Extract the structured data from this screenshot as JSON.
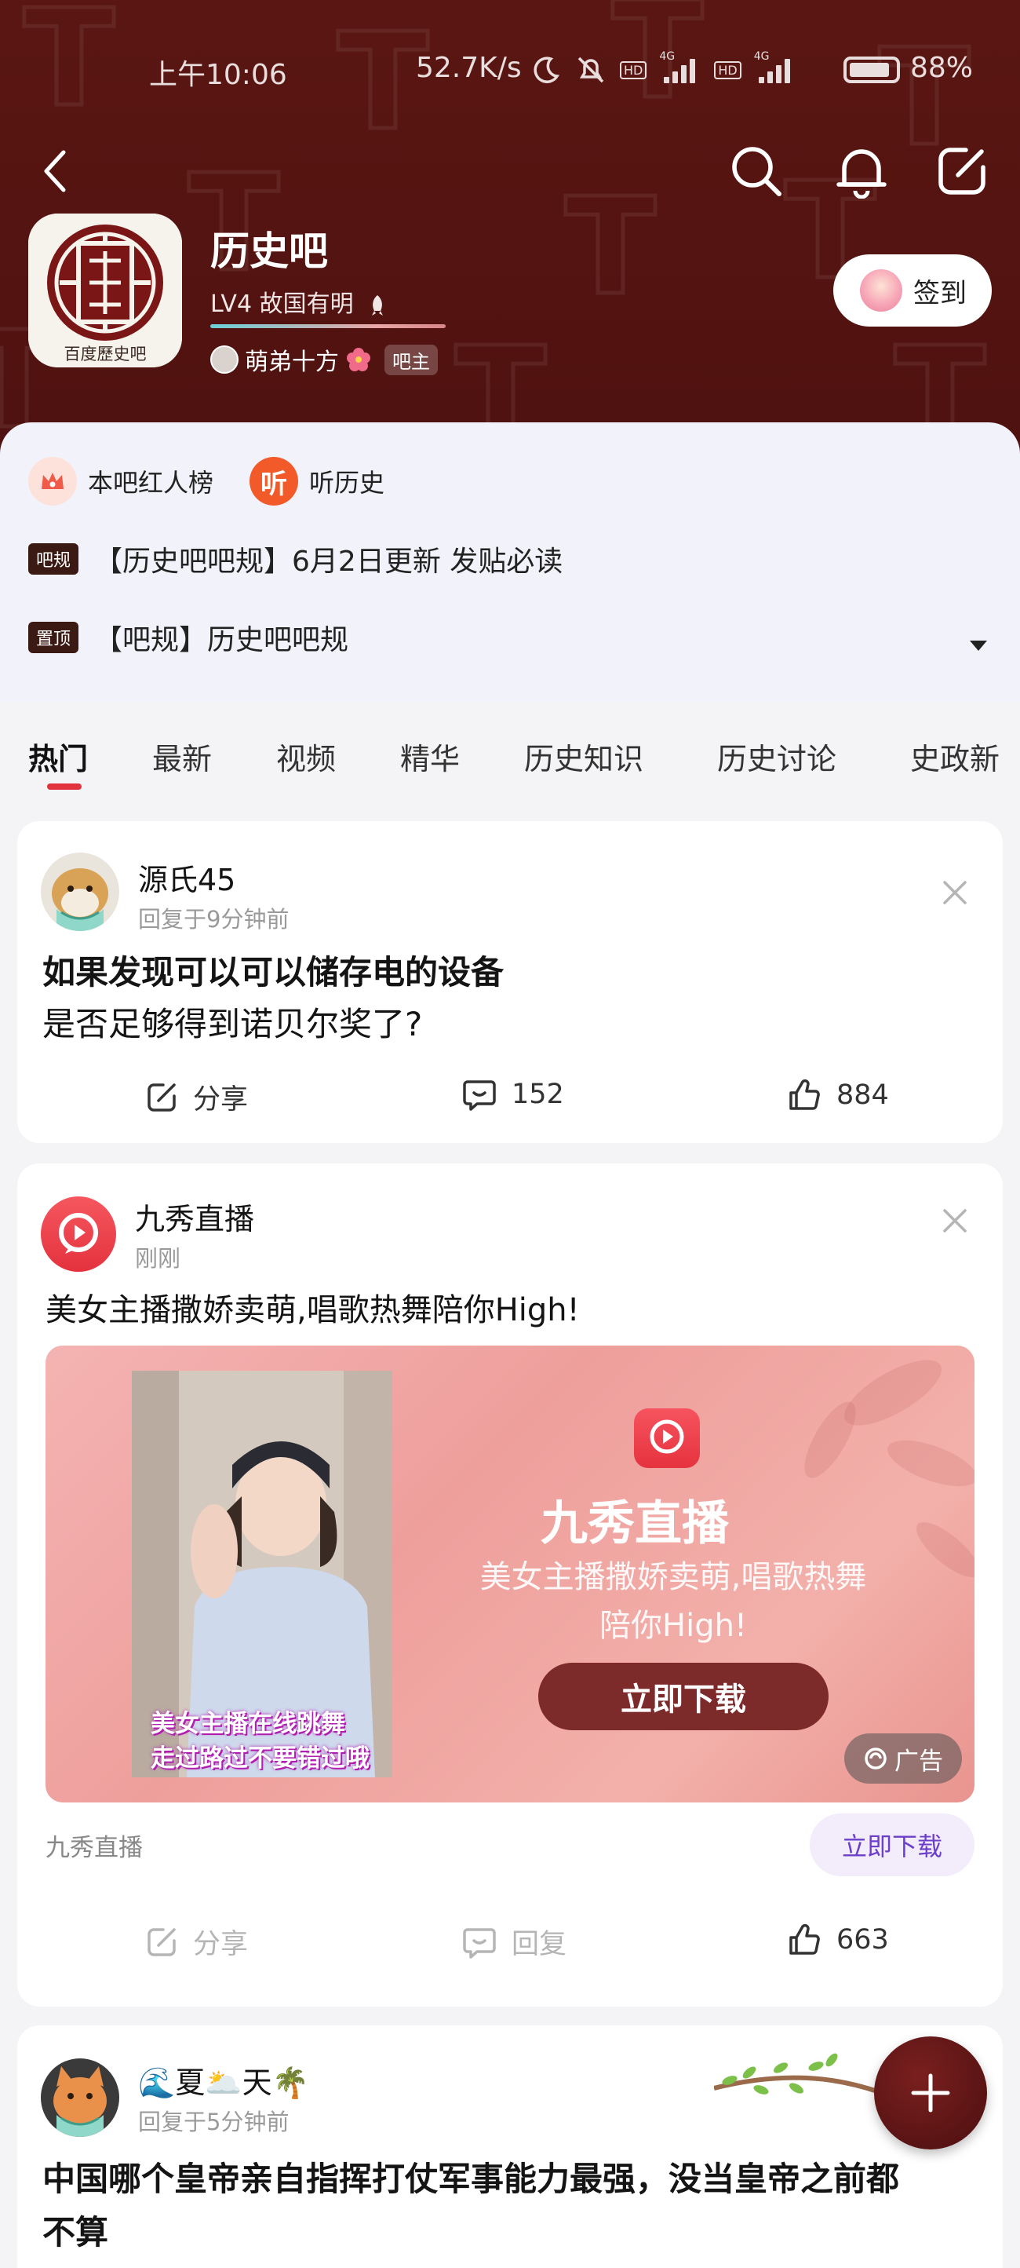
{
  "status_bar": {
    "time": "上午10:06",
    "net_speed": "52.7K/s",
    "net_a": "4G",
    "net_b": "4G",
    "battery": "88%"
  },
  "forum": {
    "name": "历史吧",
    "level": "LV4 故国有明",
    "level_icon": "rocket-icon",
    "owner_name": "萌弟十方",
    "owner_tag": "吧主",
    "logo_text": "百度歷史吧",
    "checkin_label": "签到"
  },
  "shortcuts": [
    {
      "label": "本吧红人榜",
      "icon": "crown-icon",
      "color": "#f05a48"
    },
    {
      "label": "听历史",
      "icon": "listen-icon",
      "color": "#f25a2a",
      "glyph": "听"
    }
  ],
  "notices": [
    {
      "badge": "吧规",
      "text": "【历史吧吧规】6月2日更新 发贴必读"
    },
    {
      "badge": "置顶",
      "text": "【吧规】历史吧吧规"
    }
  ],
  "tabs": [
    {
      "label": "热门",
      "active": true
    },
    {
      "label": "最新"
    },
    {
      "label": "视频"
    },
    {
      "label": "精华"
    },
    {
      "label": "历史知识"
    },
    {
      "label": "历史讨论"
    },
    {
      "label": "史政新"
    }
  ],
  "posts": [
    {
      "user": "源氏45",
      "time": "回复于9分钟前",
      "title": "如果发现可以可以储存电的设备",
      "body": "是否足够得到诺贝尔奖了?",
      "share": "分享",
      "comments": "152",
      "likes": "884"
    },
    {
      "user": "九秀直播",
      "time": "刚刚",
      "body": "美女主播撒娇卖萌,唱歌热舞陪你High!",
      "ad": {
        "brand": "九秀直播",
        "slogan_line1": "美女主播撒娇卖萌,唱歌热舞",
        "slogan_line2": "陪你High!",
        "cta": "立即下载",
        "overlay_line1": "美女主播在线跳舞",
        "overlay_line2": "走过路过不要错过哦",
        "tag": "广告"
      },
      "source": "九秀直播",
      "download": "立即下载",
      "share": "分享",
      "reply": "回复",
      "likes": "663"
    },
    {
      "user": "🌊夏🌥️天🌴",
      "time": "回复于5分钟前",
      "title_line1": "中国哪个皇帝亲自指挥打仗军事能力最强，没当皇帝之前都",
      "title_line2": "不算"
    }
  ],
  "colors": {
    "header_bg": "#5a1612",
    "accent_red": "#e0333d",
    "fab_bg": "#5c1414",
    "ad_cta_bg": "#7d2a2a",
    "download_text": "#6b3fc9"
  }
}
